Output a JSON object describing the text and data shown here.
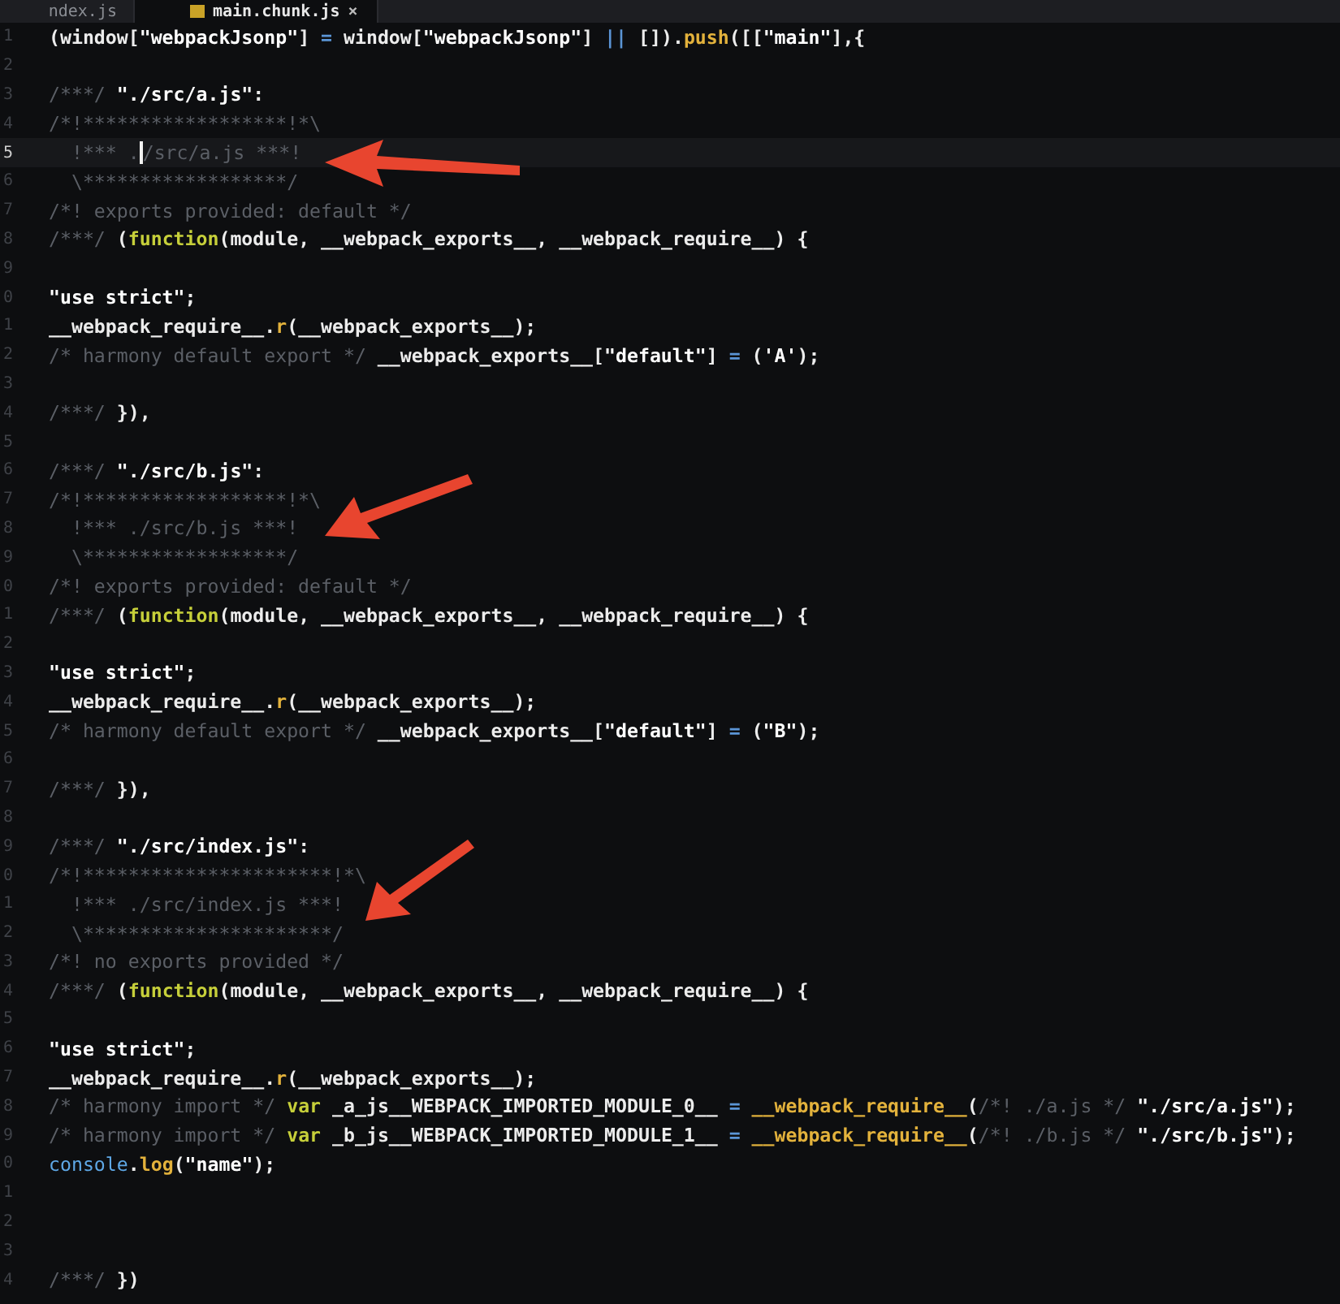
{
  "tabs": [
    {
      "label": "ndex.js",
      "selected": false
    },
    {
      "label": "main.chunk.js",
      "selected": true,
      "close": "×"
    }
  ],
  "editor": {
    "lines": [
      {
        "number": "1",
        "current": false,
        "tokens": [
          {
            "kind": "t",
            "text": "(window["
          },
          {
            "kind": "s",
            "text": "\"webpackJsonp\""
          },
          {
            "kind": "t",
            "text": "] "
          },
          {
            "kind": "o",
            "text": "="
          },
          {
            "kind": "t",
            "text": " window["
          },
          {
            "kind": "s",
            "text": "\"webpackJsonp\""
          },
          {
            "kind": "t",
            "text": "] "
          },
          {
            "kind": "o",
            "text": "||"
          },
          {
            "kind": "t",
            "text": " [])."
          },
          {
            "kind": "f",
            "text": "push"
          },
          {
            "kind": "t",
            "text": "([["
          },
          {
            "kind": "s",
            "text": "\"main\""
          },
          {
            "kind": "t",
            "text": "],{"
          }
        ]
      },
      {
        "number": "2",
        "current": false
      },
      {
        "number": "3",
        "current": false,
        "tokens": [
          {
            "kind": "c",
            "text": "/***/ "
          },
          {
            "kind": "s",
            "text": "\"./src/a.js\""
          },
          {
            "kind": "t",
            "text": ":"
          }
        ]
      },
      {
        "number": "4",
        "current": false,
        "tokens": [
          {
            "kind": "c",
            "text": "/*!******************!*\\"
          }
        ]
      },
      {
        "number": "5",
        "current": true,
        "tokens": [
          {
            "kind": "c",
            "text": "  !*** ."
          },
          {
            "kind": "caret"
          },
          {
            "kind": "c",
            "text": "/src/a.js ***!"
          }
        ]
      },
      {
        "number": "6",
        "current": false,
        "tokens": [
          {
            "kind": "c",
            "text": "  \\******************/"
          }
        ]
      },
      {
        "number": "7",
        "current": false,
        "tokens": [
          {
            "kind": "c",
            "text": "/*! exports provided: default */"
          }
        ]
      },
      {
        "number": "8",
        "current": false,
        "tokens": [
          {
            "kind": "c",
            "text": "/***/ "
          },
          {
            "kind": "t",
            "text": "("
          },
          {
            "kind": "k",
            "text": "function"
          },
          {
            "kind": "t",
            "text": "(module, __webpack_exports__, __webpack_require__) {"
          }
        ]
      },
      {
        "number": "9",
        "current": false
      },
      {
        "number": "0",
        "current": false,
        "tokens": [
          {
            "kind": "s",
            "text": "\"use strict\""
          },
          {
            "kind": "t",
            "text": ";"
          }
        ]
      },
      {
        "number": "1",
        "current": false,
        "tokens": [
          {
            "kind": "t",
            "text": "__webpack_require__."
          },
          {
            "kind": "f",
            "text": "r"
          },
          {
            "kind": "t",
            "text": "(__webpack_exports__);"
          }
        ]
      },
      {
        "number": "2",
        "current": false,
        "tokens": [
          {
            "kind": "c",
            "text": "/* harmony default export */ "
          },
          {
            "kind": "t",
            "text": "__webpack_exports__["
          },
          {
            "kind": "s",
            "text": "\"default\""
          },
          {
            "kind": "t",
            "text": "] "
          },
          {
            "kind": "o",
            "text": "="
          },
          {
            "kind": "t",
            "text": " ("
          },
          {
            "kind": "s",
            "text": "'A'"
          },
          {
            "kind": "t",
            "text": ");"
          }
        ]
      },
      {
        "number": "3",
        "current": false
      },
      {
        "number": "4",
        "current": false,
        "tokens": [
          {
            "kind": "c",
            "text": "/***/ "
          },
          {
            "kind": "t",
            "text": "}),"
          }
        ]
      },
      {
        "number": "5",
        "current": false
      },
      {
        "number": "6",
        "current": false,
        "tokens": [
          {
            "kind": "c",
            "text": "/***/ "
          },
          {
            "kind": "s",
            "text": "\"./src/b.js\""
          },
          {
            "kind": "t",
            "text": ":"
          }
        ]
      },
      {
        "number": "7",
        "current": false,
        "tokens": [
          {
            "kind": "c",
            "text": "/*!******************!*\\"
          }
        ]
      },
      {
        "number": "8",
        "current": false,
        "tokens": [
          {
            "kind": "c",
            "text": "  !*** ./src/b.js ***!"
          }
        ]
      },
      {
        "number": "9",
        "current": false,
        "tokens": [
          {
            "kind": "c",
            "text": "  \\******************/"
          }
        ]
      },
      {
        "number": "0",
        "current": false,
        "tokens": [
          {
            "kind": "c",
            "text": "/*! exports provided: default */"
          }
        ]
      },
      {
        "number": "1",
        "current": false,
        "tokens": [
          {
            "kind": "c",
            "text": "/***/ "
          },
          {
            "kind": "t",
            "text": "("
          },
          {
            "kind": "k",
            "text": "function"
          },
          {
            "kind": "t",
            "text": "(module, __webpack_exports__, __webpack_require__) {"
          }
        ]
      },
      {
        "number": "2",
        "current": false
      },
      {
        "number": "3",
        "current": false,
        "tokens": [
          {
            "kind": "s",
            "text": "\"use strict\""
          },
          {
            "kind": "t",
            "text": ";"
          }
        ]
      },
      {
        "number": "4",
        "current": false,
        "tokens": [
          {
            "kind": "t",
            "text": "__webpack_require__."
          },
          {
            "kind": "f",
            "text": "r"
          },
          {
            "kind": "t",
            "text": "(__webpack_exports__);"
          }
        ]
      },
      {
        "number": "5",
        "current": false,
        "tokens": [
          {
            "kind": "c",
            "text": "/* harmony default export */ "
          },
          {
            "kind": "t",
            "text": "__webpack_exports__["
          },
          {
            "kind": "s",
            "text": "\"default\""
          },
          {
            "kind": "t",
            "text": "] "
          },
          {
            "kind": "o",
            "text": "="
          },
          {
            "kind": "t",
            "text": " ("
          },
          {
            "kind": "s",
            "text": "\"B\""
          },
          {
            "kind": "t",
            "text": ");"
          }
        ]
      },
      {
        "number": "6",
        "current": false
      },
      {
        "number": "7",
        "current": false,
        "tokens": [
          {
            "kind": "c",
            "text": "/***/ "
          },
          {
            "kind": "t",
            "text": "}),"
          }
        ]
      },
      {
        "number": "8",
        "current": false
      },
      {
        "number": "9",
        "current": false,
        "tokens": [
          {
            "kind": "c",
            "text": "/***/ "
          },
          {
            "kind": "s",
            "text": "\"./src/index.js\""
          },
          {
            "kind": "t",
            "text": ":"
          }
        ]
      },
      {
        "number": "0",
        "current": false,
        "tokens": [
          {
            "kind": "c",
            "text": "/*!**********************!*\\"
          }
        ]
      },
      {
        "number": "1",
        "current": false,
        "tokens": [
          {
            "kind": "c",
            "text": "  !*** ./src/index.js ***!"
          }
        ]
      },
      {
        "number": "2",
        "current": false,
        "tokens": [
          {
            "kind": "c",
            "text": "  \\**********************/"
          }
        ]
      },
      {
        "number": "3",
        "current": false,
        "tokens": [
          {
            "kind": "c",
            "text": "/*! no exports provided */"
          }
        ]
      },
      {
        "number": "4",
        "current": false,
        "tokens": [
          {
            "kind": "c",
            "text": "/***/ "
          },
          {
            "kind": "t",
            "text": "("
          },
          {
            "kind": "k",
            "text": "function"
          },
          {
            "kind": "t",
            "text": "(module, __webpack_exports__, __webpack_require__) {"
          }
        ]
      },
      {
        "number": "5",
        "current": false
      },
      {
        "number": "6",
        "current": false,
        "tokens": [
          {
            "kind": "s",
            "text": "\"use strict\""
          },
          {
            "kind": "t",
            "text": ";"
          }
        ]
      },
      {
        "number": "7",
        "current": false,
        "tokens": [
          {
            "kind": "t",
            "text": "__webpack_require__."
          },
          {
            "kind": "f",
            "text": "r"
          },
          {
            "kind": "t",
            "text": "(__webpack_exports__);"
          }
        ]
      },
      {
        "number": "8",
        "current": false,
        "tokens": [
          {
            "kind": "c",
            "text": "/* harmony import */ "
          },
          {
            "kind": "k",
            "text": "var"
          },
          {
            "kind": "t",
            "text": " _a_js__WEBPACK_IMPORTED_MODULE_0__ "
          },
          {
            "kind": "o",
            "text": "="
          },
          {
            "kind": "f",
            "text": " __webpack_require__"
          },
          {
            "kind": "t",
            "text": "("
          },
          {
            "kind": "c",
            "text": "/*! ./a.js */ "
          },
          {
            "kind": "s",
            "text": "\"./src/a.js\""
          },
          {
            "kind": "t",
            "text": ");"
          }
        ]
      },
      {
        "number": "9",
        "current": false,
        "tokens": [
          {
            "kind": "c",
            "text": "/* harmony import */ "
          },
          {
            "kind": "k",
            "text": "var"
          },
          {
            "kind": "t",
            "text": " _b_js__WEBPACK_IMPORTED_MODULE_1__ "
          },
          {
            "kind": "o",
            "text": "="
          },
          {
            "kind": "f",
            "text": " __webpack_require__"
          },
          {
            "kind": "t",
            "text": "("
          },
          {
            "kind": "c",
            "text": "/*! ./b.js */ "
          },
          {
            "kind": "s",
            "text": "\"./src/b.js\""
          },
          {
            "kind": "t",
            "text": ");"
          }
        ]
      },
      {
        "number": "0",
        "current": false,
        "tokens": [
          {
            "kind": "b",
            "text": "console"
          },
          {
            "kind": "t",
            "text": "."
          },
          {
            "kind": "f",
            "text": "log"
          },
          {
            "kind": "t",
            "text": "("
          },
          {
            "kind": "s",
            "text": "\"name\""
          },
          {
            "kind": "t",
            "text": ");"
          }
        ]
      },
      {
        "number": "1",
        "current": false
      },
      {
        "number": "2",
        "current": false
      },
      {
        "number": "3",
        "current": false
      },
      {
        "number": "4",
        "current": false,
        "tokens": [
          {
            "kind": "c",
            "text": "/***/ "
          },
          {
            "kind": "t",
            "text": "})"
          }
        ]
      }
    ]
  }
}
